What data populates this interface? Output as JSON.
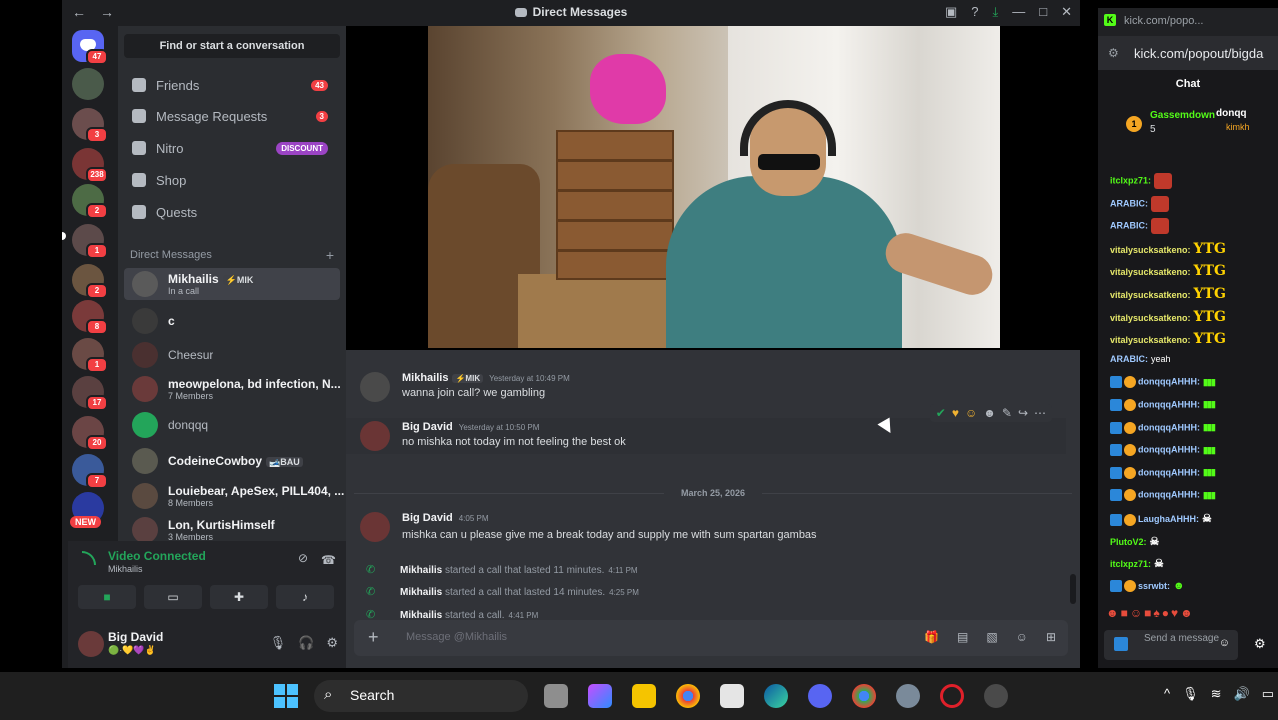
{
  "discord": {
    "window_title": "Direct Messages",
    "sidebar": {
      "search_label": "Find or start a conversation",
      "nav": [
        {
          "label": "Friends",
          "count": "43"
        },
        {
          "label": "Message Requests",
          "count": "3"
        },
        {
          "label": "Nitro",
          "badge": "DISCOUNT"
        },
        {
          "label": "Shop"
        },
        {
          "label": "Quests"
        }
      ],
      "dm_header": "Direct Messages",
      "dms": [
        {
          "name": "Mikhailis",
          "tag": "⚡MIK",
          "sub": "In a call"
        },
        {
          "name": "c"
        },
        {
          "name": "Cheesur"
        },
        {
          "name": "meowpelona, bd infection, N...",
          "sub": "7 Members"
        },
        {
          "name": "donqqq"
        },
        {
          "name": "CodeineCowboy",
          "tag": "🎿BAU"
        },
        {
          "name": "Louiebear, ApeSex, PILL404, ...",
          "sub": "8 Members"
        },
        {
          "name": "Lon, KurtisHimself",
          "sub": "3 Members"
        }
      ]
    },
    "guild_badges": [
      "47",
      "3",
      "238",
      "2",
      "1",
      "2",
      "8",
      "1",
      "17",
      "20",
      "7"
    ],
    "guild_new": "NEW",
    "voice": {
      "status": "Video Connected",
      "channel": "Mikhailis"
    },
    "user": {
      "name": "Big David",
      "status": "🟢·💛💜✌"
    },
    "messages": [
      {
        "author": "Mikhailis",
        "tag": "⚡MIK",
        "time": "Yesterday at 10:49 PM",
        "text": "wanna join call? we gambling"
      },
      {
        "author": "Big David",
        "time": "Yesterday at 10:50 PM",
        "text": "no mishka not today im not feeling the best ok"
      },
      {
        "author": "Big David",
        "time": "4:05 PM",
        "text": "mishka can u please give me a break today and supply me with sum spartan gambas"
      }
    ],
    "date_separator": "March 25, 2026",
    "calls": [
      {
        "who": "Mikhailis",
        "text": "started a call that lasted 11 minutes.",
        "time": "4:11 PM"
      },
      {
        "who": "Mikhailis",
        "text": "started a call that lasted 14 minutes.",
        "time": "4:25 PM"
      },
      {
        "who": "Mikhailis",
        "text": "started a call.",
        "time": "4:41 PM"
      }
    ],
    "composer_placeholder": "Message @Mikhailis"
  },
  "kick": {
    "tab_title": "kick.com/popo...",
    "url": "kick.com/popout/bigda",
    "chat_header": "Chat",
    "gifter": {
      "rank": "1",
      "name": "Gassemdown",
      "count": "5",
      "other": "donqq",
      "other2": "kimkh"
    },
    "lines": [
      {
        "user": "itclxpz71:",
        "kind": "emo"
      },
      {
        "user": "ARABIC:",
        "kind": "emo"
      },
      {
        "user": "ARABIC:",
        "kind": "emo"
      },
      {
        "user": "vitalysucksatkeno:",
        "kind": "ytg"
      },
      {
        "user": "vitalysucksatkeno:",
        "kind": "ytg"
      },
      {
        "user": "vitalysucksatkeno:",
        "kind": "ytg"
      },
      {
        "user": "vitalysucksatkeno:",
        "kind": "ytg"
      },
      {
        "user": "vitalysucksatkeno:",
        "kind": "ytg"
      },
      {
        "user": "ARABIC:",
        "kind": "text",
        "msg": "yeah"
      },
      {
        "user": "donqqqAHHH:",
        "kind": "bars"
      },
      {
        "user": "donqqqAHHH:",
        "kind": "bars"
      },
      {
        "user": "donqqqAHHH:",
        "kind": "bars"
      },
      {
        "user": "donqqqAHHH:",
        "kind": "bars"
      },
      {
        "user": "donqqqAHHH:",
        "kind": "bars"
      },
      {
        "user": "donqqqAHHH:",
        "kind": "bars"
      },
      {
        "user": "LaughaAHHH:",
        "kind": "skull"
      },
      {
        "user": "PlutoV2:",
        "kind": "skull"
      },
      {
        "user": "itclxpz71:",
        "kind": "skull"
      },
      {
        "user": "ssrwbt:",
        "kind": "green"
      }
    ],
    "ytg_text": "YTG",
    "send_placeholder": "Send a message"
  },
  "taskbar": {
    "search_label": "Search"
  }
}
